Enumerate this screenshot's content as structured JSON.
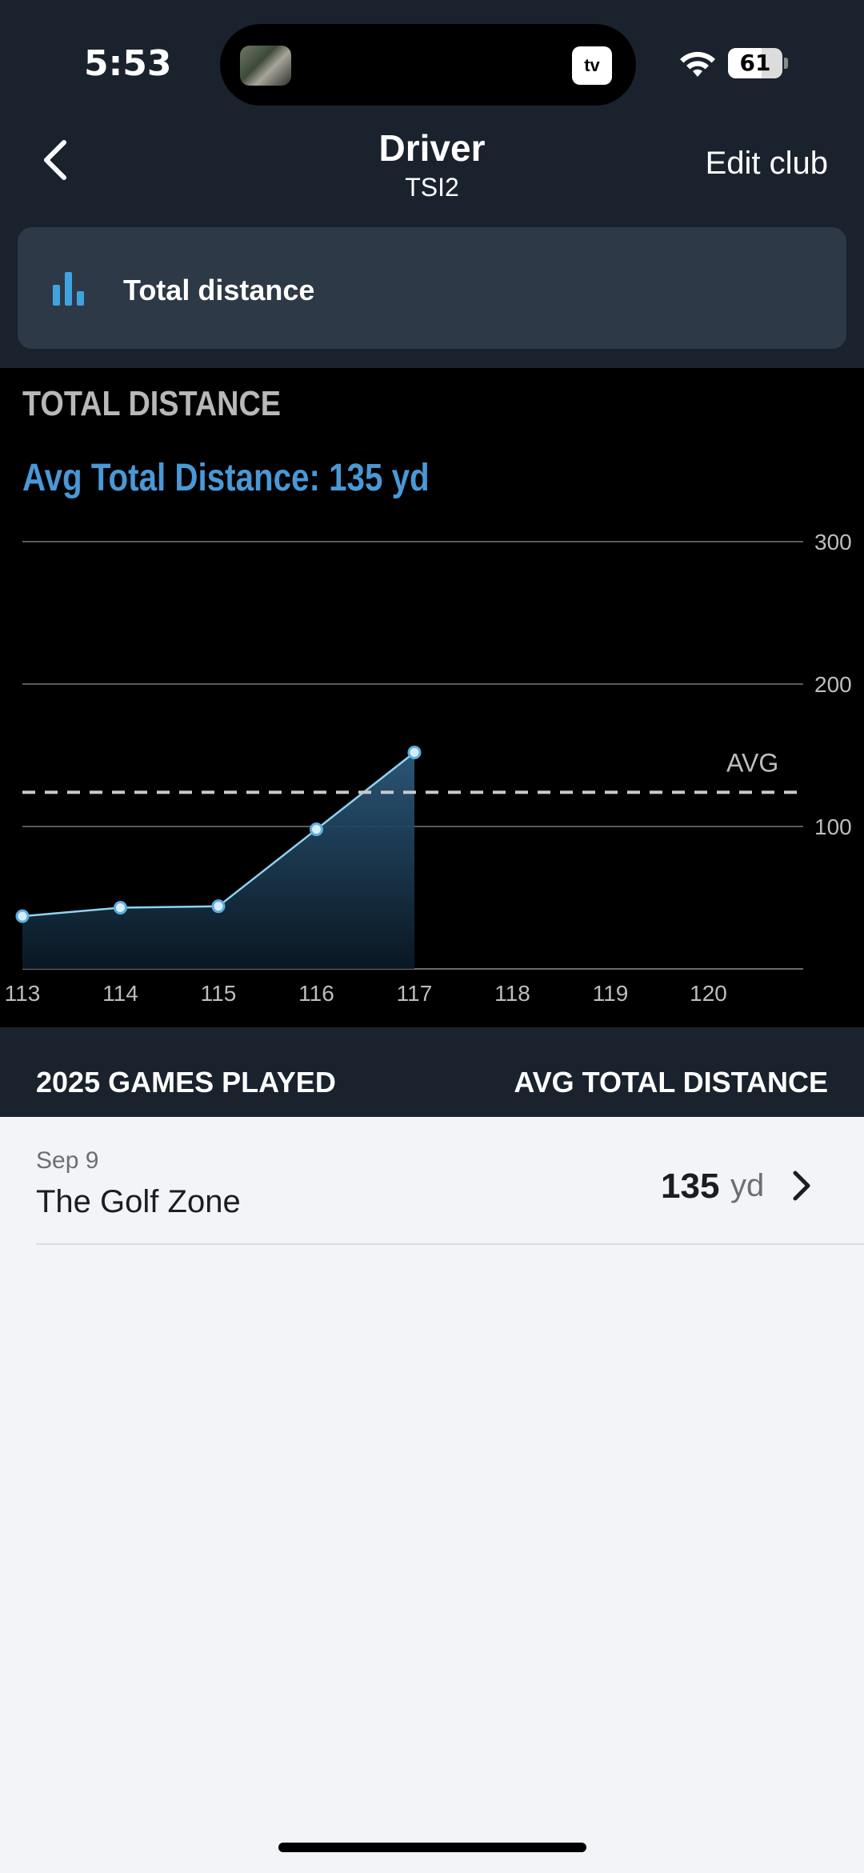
{
  "status_bar": {
    "time": "5:53",
    "tv_badge": "tv",
    "battery": "61"
  },
  "nav": {
    "title": "Driver",
    "subtitle": "TSI2",
    "edit_label": "Edit club"
  },
  "metric_selector": {
    "label": "Total distance",
    "icon": "bar-chart-icon"
  },
  "chart_section": {
    "heading": "TOTAL DISTANCE",
    "avg_text": "Avg Total Distance: 135 yd"
  },
  "chart_data": {
    "type": "area",
    "x": [
      113,
      114,
      115,
      116,
      117
    ],
    "values": [
      37,
      43,
      44,
      98,
      152
    ],
    "x_ticks": [
      "113",
      "114",
      "115",
      "116",
      "117",
      "118",
      "119",
      "120"
    ],
    "y_ticks": [
      "100",
      "200",
      "300"
    ],
    "ylim": [
      0,
      300
    ],
    "xlim": [
      113,
      121
    ],
    "avg_value": 124,
    "avg_label": "AVG",
    "grid": true,
    "colors": {
      "line": "#8fd3f4",
      "fill_top": "#2d5a7d",
      "avg_line": "#c9c9c9"
    }
  },
  "games_header": {
    "left": "2025 GAMES PLAYED",
    "right": "AVG TOTAL DISTANCE"
  },
  "games": [
    {
      "date": "Sep 9",
      "name": "The Golf Zone",
      "value": "135",
      "unit": "yd"
    }
  ],
  "colors": {
    "header_bg": "#1a222d",
    "accent": "#4a98d6"
  }
}
